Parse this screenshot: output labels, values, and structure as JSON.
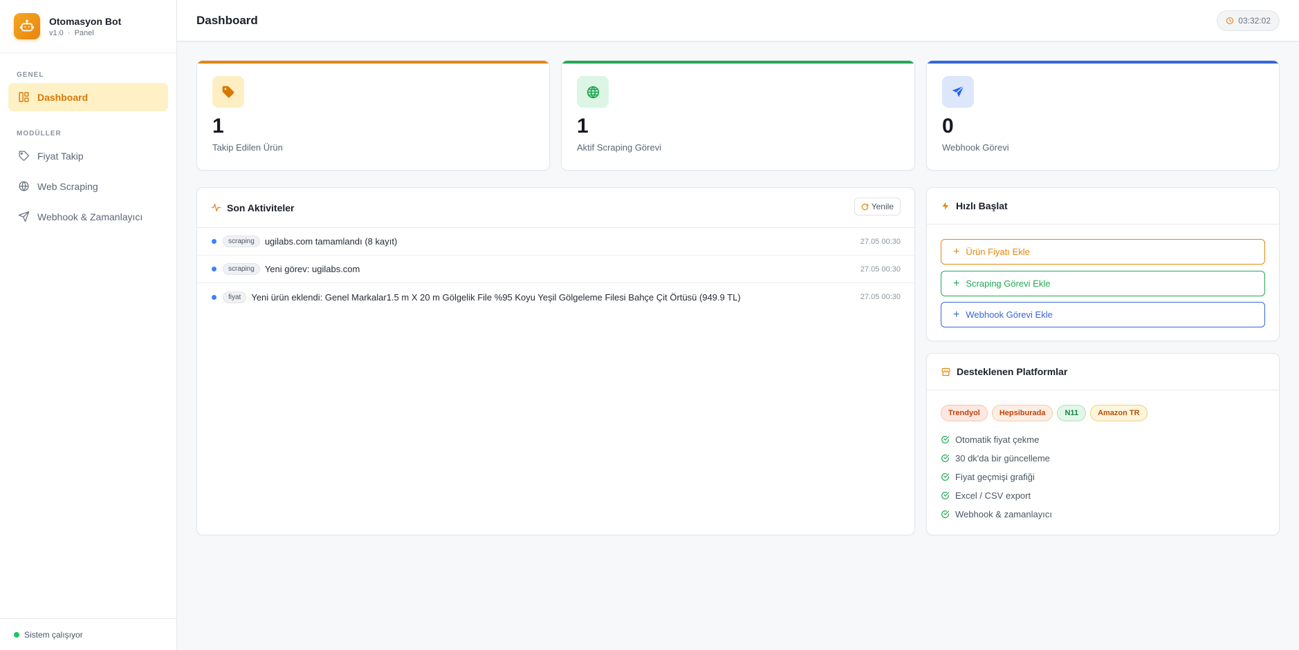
{
  "app": {
    "title": "Otomasyon Bot",
    "version": "v1.0",
    "separator": "·",
    "subtitle": "Panel"
  },
  "sidebar": {
    "section_general": "GENEL",
    "section_modules": "MODÜLLER",
    "items": [
      {
        "label": "Dashboard",
        "icon": "layout-dashboard-icon",
        "active": true
      },
      {
        "label": "Fiyat Takip",
        "icon": "tag-icon",
        "active": false
      },
      {
        "label": "Web Scraping",
        "icon": "globe-icon",
        "active": false
      },
      {
        "label": "Webhook & Zamanlayıcı",
        "icon": "send-icon",
        "active": false
      }
    ],
    "status_text": "Sistem çalışıyor"
  },
  "header": {
    "title": "Dashboard",
    "clock": "03:32:02"
  },
  "stats": [
    {
      "value": "1",
      "label": "Takip Edilen Ürün",
      "icon": "tag-icon",
      "accent": "#e8850c"
    },
    {
      "value": "1",
      "label": "Aktif Scraping Görevi",
      "icon": "globe-icon",
      "accent": "#22a853"
    },
    {
      "value": "0",
      "label": "Webhook Görevi",
      "icon": "send-icon",
      "accent": "#3366dd"
    }
  ],
  "activities": {
    "title": "Son Aktiviteler",
    "refresh_label": "Yenile",
    "items": [
      {
        "tag": "scraping",
        "text": "ugilabs.com tamamlandı (8 kayıt)",
        "time": "27.05 00:30"
      },
      {
        "tag": "scraping",
        "text": "Yeni görev: ugilabs.com",
        "time": "27.05 00:30"
      },
      {
        "tag": "fiyat",
        "text": "Yeni ürün eklendi: Genel Markalar1.5 m X 20 m Gölgelik File %95 Koyu Yeşil Gölgeleme Filesi Bahçe Çit Örtüsü (949.9 TL)",
        "time": "27.05 00:30"
      }
    ]
  },
  "quick_start": {
    "title": "Hızlı Başlat",
    "buttons": [
      {
        "label": "Ürün Fiyatı Ekle",
        "color": "#e8850c"
      },
      {
        "label": "Scraping Görevi Ekle",
        "color": "#22a853"
      },
      {
        "label": "Webhook Görevi Ekle",
        "color": "#3366dd"
      }
    ]
  },
  "platforms": {
    "title": "Desteklenen Platformlar",
    "tags": [
      {
        "label": "Trendyol",
        "color": "#c2410c",
        "bg": "#fde8e1",
        "border": "#f6c3b0"
      },
      {
        "label": "Hepsiburada",
        "color": "#c2410c",
        "bg": "#fdeee3",
        "border": "#f7c8a5"
      },
      {
        "label": "N11",
        "color": "#15803d",
        "bg": "#e3f7e9",
        "border": "#a9e2bb"
      },
      {
        "label": "Amazon TR",
        "color": "#b45309",
        "bg": "#fdf5dc",
        "border": "#f1d27a"
      }
    ],
    "features": [
      "Otomatik fiyat çekme",
      "30 dk'da bir güncelleme",
      "Fiyat geçmişi grafiği",
      "Excel / CSV export",
      "Webhook & zamanlayıcı"
    ]
  }
}
